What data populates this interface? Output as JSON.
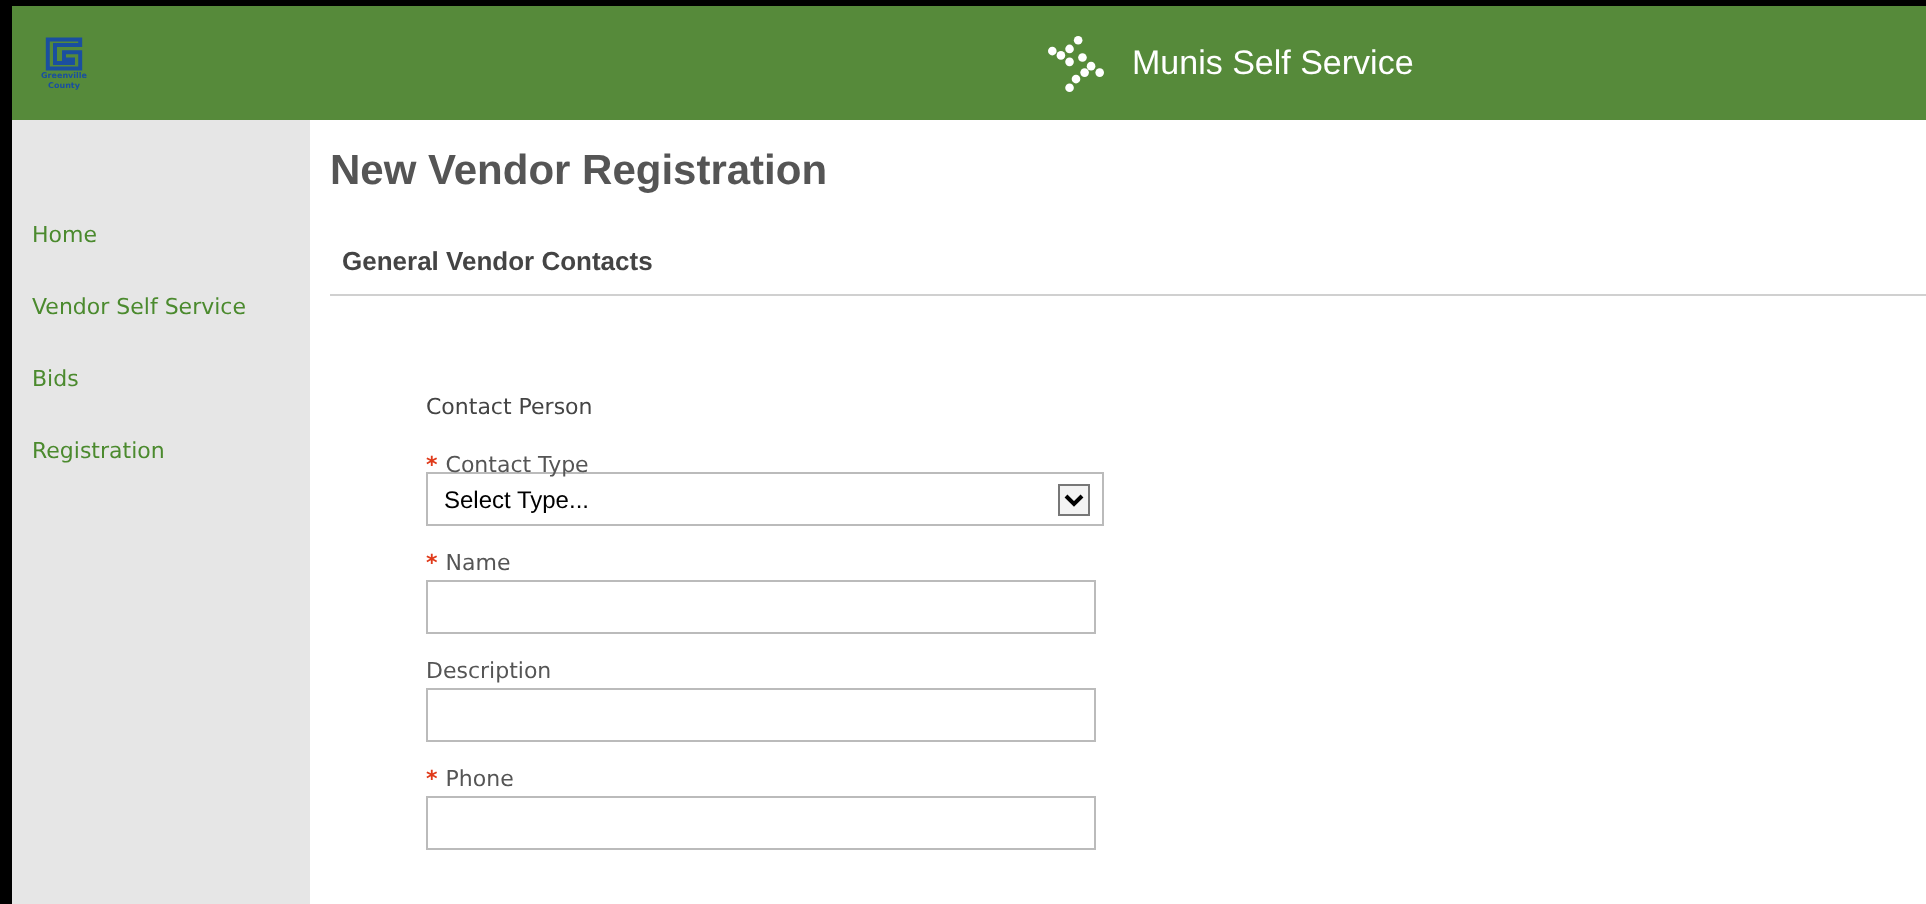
{
  "header": {
    "logo_lines": [
      "Greenville",
      "County"
    ],
    "title": "Munis Self Service"
  },
  "sidebar": {
    "items": [
      {
        "label": "Home"
      },
      {
        "label": "Vendor Self Service"
      },
      {
        "label": "Bids"
      },
      {
        "label": "Registration"
      }
    ]
  },
  "page": {
    "title": "New Vendor Registration",
    "section": "General Vendor Contacts",
    "group": "Contact Person",
    "fields": [
      {
        "kind": "select",
        "label": "Contact Type",
        "required_mark": "*",
        "value": "Select Type..."
      },
      {
        "kind": "text",
        "label": "Name",
        "required_mark": "*"
      },
      {
        "kind": "text",
        "label": "Description"
      },
      {
        "kind": "text",
        "label": "Phone",
        "required_mark": "*"
      }
    ]
  }
}
